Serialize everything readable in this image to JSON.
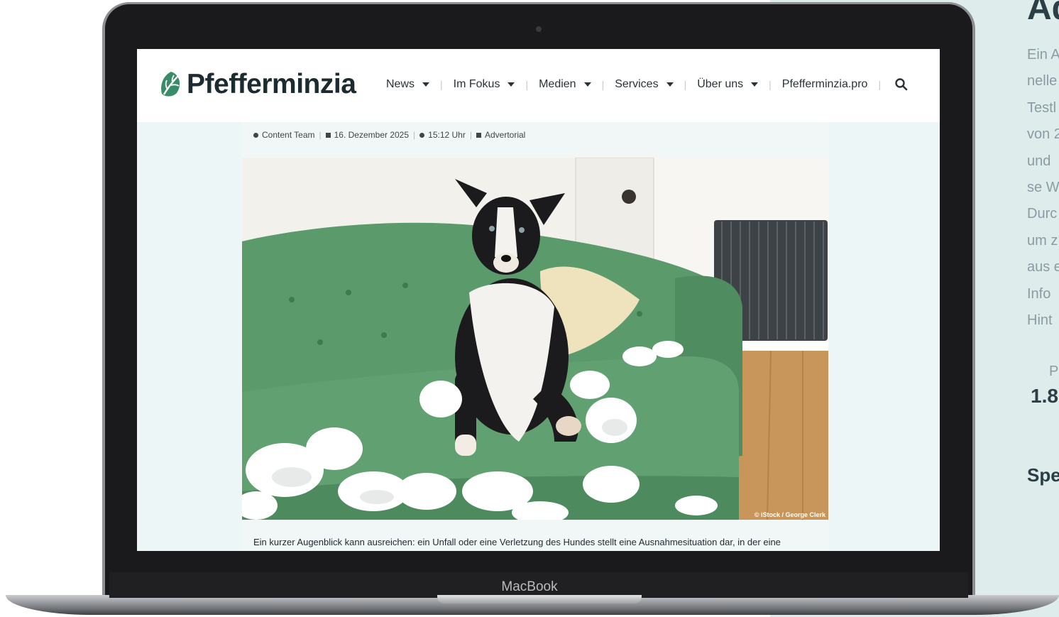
{
  "side_panel": {
    "heading": "Ad",
    "lines": [
      "Ein A",
      "nelle",
      "Testl",
      "von 2",
      "und",
      "se W",
      "Durc",
      "um z",
      "aus e",
      "Info",
      "Hint"
    ],
    "stat_label": "P",
    "stat_value": "1.8",
    "subheading": "Spe"
  },
  "laptop": {
    "brand": "MacBook"
  },
  "site": {
    "logo_text": "Pfefferminzia",
    "nav": [
      {
        "label": "News",
        "has_caret": true
      },
      {
        "label": "Im Fokus",
        "has_caret": true
      },
      {
        "label": "Medien",
        "has_caret": true
      },
      {
        "label": "Services",
        "has_caret": true
      },
      {
        "label": "Über uns",
        "has_caret": true
      },
      {
        "label": "Pfefferminzia.pro",
        "has_caret": false
      }
    ],
    "search_icon": "search-icon"
  },
  "article": {
    "meta": {
      "author": "Content Team",
      "date": "16. Dezember 2025",
      "time": "15:12 Uhr",
      "category": "Advertorial"
    },
    "photo_credit": "© iStock / George Clerk",
    "caption": "Ein kurzer Augenblick kann ausreichen: ein Unfall oder eine Verletzung des Hundes stellt eine Ausnahmesituation dar, in der eine"
  },
  "colors": {
    "sofa": "#5d9a6c",
    "screen_bg": "#edf6f7",
    "panel_bg": "#dfecec"
  }
}
